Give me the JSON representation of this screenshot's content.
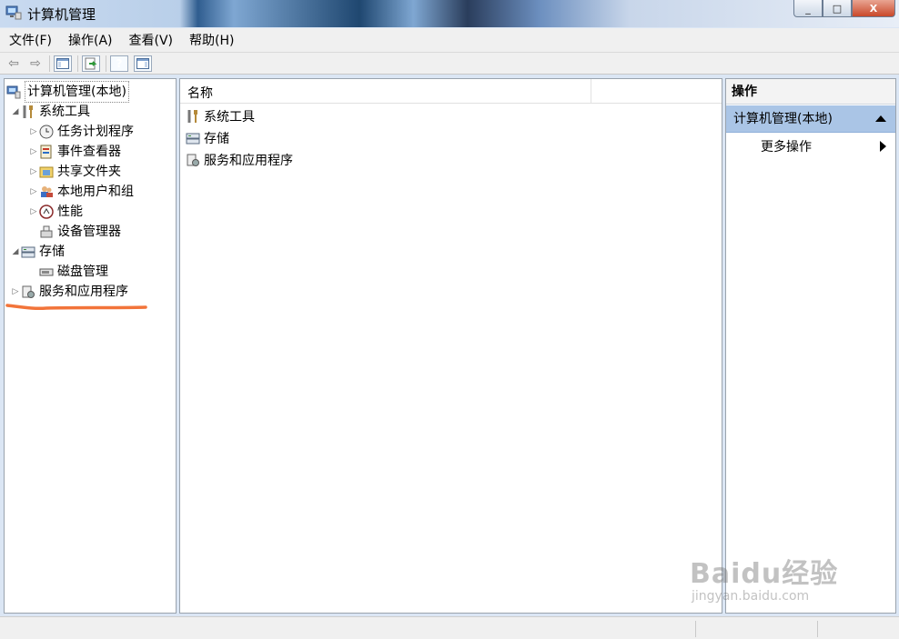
{
  "window": {
    "title": "计算机管理",
    "buttons": [
      "_",
      "□",
      "X"
    ]
  },
  "menu": [
    {
      "label": "文件(F)"
    },
    {
      "label": "操作(A)"
    },
    {
      "label": "查看(V)"
    },
    {
      "label": "帮助(H)"
    }
  ],
  "toolbar": {
    "back_icon": "back-arrow-icon",
    "forward_icon": "forward-arrow-icon",
    "help_label": "?"
  },
  "tree": {
    "root": "计算机管理(本地)",
    "system_tools": "系统工具",
    "task_scheduler": "任务计划程序",
    "event_viewer": "事件查看器",
    "shared_folders": "共享文件夹",
    "local_users": "本地用户和组",
    "performance": "性能",
    "device_manager": "设备管理器",
    "storage": "存储",
    "disk_management": "磁盘管理",
    "services_apps": "服务和应用程序"
  },
  "list": {
    "column_name": "名称",
    "items": [
      "系统工具",
      "存储",
      "服务和应用程序"
    ]
  },
  "actions": {
    "header": "操作",
    "section": "计算机管理(本地)",
    "more": "更多操作"
  },
  "annotation_color": "#f2743a",
  "watermark": {
    "logo": "Baidu经验",
    "url": "jingyan.baidu.com"
  }
}
